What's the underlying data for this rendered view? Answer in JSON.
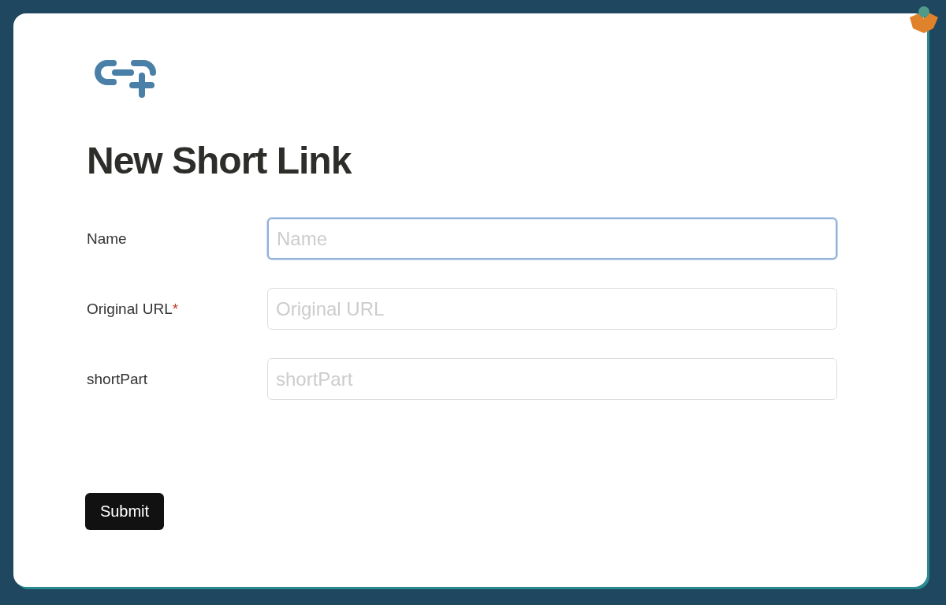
{
  "title": "New Short Link",
  "fields": [
    {
      "label": "Name",
      "placeholder": "Name",
      "focused": true
    },
    {
      "label": "Original URL",
      "required_mark": "*",
      "placeholder": "Original URL",
      "focused": false
    },
    {
      "label": "shortPart",
      "placeholder": "shortPart",
      "focused": false
    }
  ],
  "submit_button": "Submit"
}
